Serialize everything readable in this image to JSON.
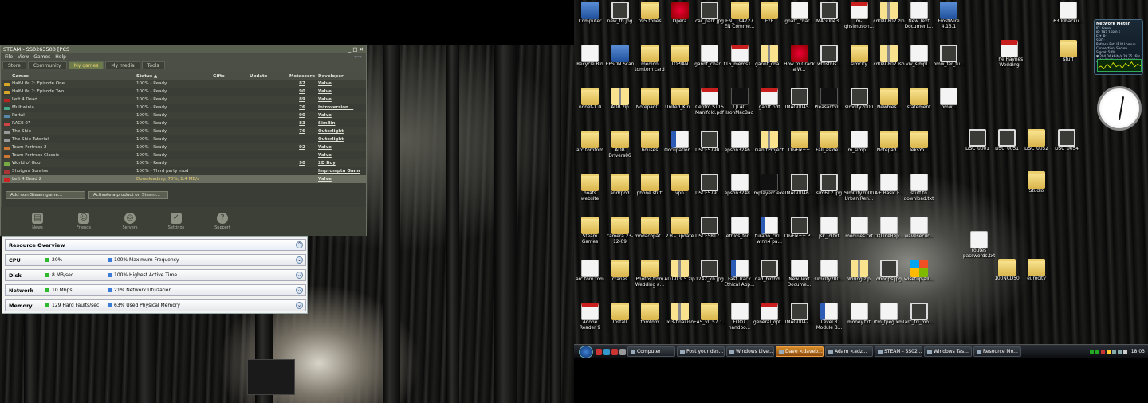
{
  "steam": {
    "title": "STEAM - SS0263500 [PCS",
    "menu": [
      "File",
      "View",
      "Games",
      "Help"
    ],
    "tabs": [
      "Store",
      "Community",
      "My games",
      "My media",
      "Tools"
    ],
    "columns": {
      "games": "Games",
      "status": "Status ▲",
      "gifts": "Gifts",
      "update": "Update",
      "meta": "Metascore",
      "dev": "Developer"
    },
    "games": [
      {
        "name": "Half-Life 2: Episode One",
        "status": "100% - Ready",
        "meta": "87",
        "dev": "Valve"
      },
      {
        "name": "Half-Life 2: Episode Two",
        "status": "100% - Ready",
        "meta": "90",
        "dev": "Valve"
      },
      {
        "name": "Left 4 Dead",
        "status": "100% - Ready",
        "meta": "89",
        "dev": "Valve"
      },
      {
        "name": "Multiwinia",
        "status": "100% - Ready",
        "meta": "76",
        "dev": "Introversion..."
      },
      {
        "name": "Portal",
        "status": "100% - Ready",
        "meta": "90",
        "dev": "Valve"
      },
      {
        "name": "RACE 07",
        "status": "100% - Ready",
        "meta": "83",
        "dev": "SimBin"
      },
      {
        "name": "The Ship",
        "status": "100% - Ready",
        "meta": "76",
        "dev": "Outerlight"
      },
      {
        "name": "The Ship Tutorial",
        "status": "100% - Ready",
        "meta": "",
        "dev": "Outerlight"
      },
      {
        "name": "Team Fortress 2",
        "status": "100% - Ready",
        "meta": "92",
        "dev": "Valve"
      },
      {
        "name": "Team Fortress Classic",
        "status": "100% - Ready",
        "meta": "",
        "dev": "Valve"
      },
      {
        "name": "World of Goo",
        "status": "100% - Ready",
        "meta": "90",
        "dev": "2D Boy"
      },
      {
        "name": "Shotgun Sunrise",
        "status": "100% - Third party mod",
        "meta": "",
        "dev": "Impromptu Game"
      },
      {
        "name": "Left 4 Dead 2",
        "status": "Downloading: 70%, 1.4 MB/s",
        "meta": "",
        "dev": "Valve"
      }
    ],
    "buttons": {
      "add": "Add non-Steam game...",
      "activate": "Activate a product on Steam..."
    },
    "bottom": [
      "News",
      "Friends",
      "Servers",
      "Settings",
      "Support"
    ]
  },
  "resmon": {
    "title": "Resource Overview",
    "rows": [
      {
        "label": "CPU",
        "v1": "20%",
        "v2": "100% Maximum Frequency",
        "c1": "#2db82d",
        "c2": "#3a7bd5"
      },
      {
        "label": "Disk",
        "v1": "8 MB/sec",
        "v2": "100% Highest Active Time",
        "c1": "#2db82d",
        "c2": "#3a7bd5"
      },
      {
        "label": "Network",
        "v1": "10 Mbps",
        "v2": "21% Network Utilization",
        "c1": "#2db82d",
        "c2": "#3a7bd5"
      },
      {
        "label": "Memory",
        "v1": "129 Hard Faults/sec",
        "v2": "63% Used Physical Memory",
        "c1": "#2db82d",
        "c2": "#3a7bd5"
      }
    ]
  },
  "desktop": {
    "col0": [
      {
        "label": "Computer",
        "type": "blue"
      },
      {
        "label": "Recycle Bin",
        "type": "doc"
      },
      {
        "label": "nonet-1.0",
        "type": "folder"
      },
      {
        "label": "arc tomtom",
        "type": "folder"
      },
      {
        "label": "boats website",
        "type": "folder"
      },
      {
        "label": "Steam Games",
        "type": "folder"
      },
      {
        "label": "arc tom tom",
        "type": "doc"
      },
      {
        "label": "Adobe Reader 9",
        "type": "pdf"
      }
    ],
    "col1": [
      {
        "label": "new_tb.jpg",
        "type": "img"
      },
      {
        "label": "EPSON Scan",
        "type": "blue"
      },
      {
        "label": "ADB.zip",
        "type": "zip"
      },
      {
        "label": "ADB Drivers86",
        "type": "folder"
      },
      {
        "label": "andrpod",
        "type": "folder"
      },
      {
        "label": "camera 23-12-09",
        "type": "folder"
      },
      {
        "label": "cranes",
        "type": "folder"
      },
      {
        "label": "Install",
        "type": "folder"
      }
    ],
    "col2": [
      {
        "label": "n95 tones",
        "type": "folder"
      },
      {
        "label": "medion tomtom card",
        "type": "folder"
      },
      {
        "label": "NotepadC...",
        "type": "folder"
      },
      {
        "label": "houses",
        "type": "folder"
      },
      {
        "label": "phone stuff",
        "type": "folder"
      },
      {
        "label": "modacopat...",
        "type": "folder"
      },
      {
        "label": "Photos from Wedding a...",
        "type": "folder"
      },
      {
        "label": "tomtom",
        "type": "folder"
      }
    ],
    "col3": [
      {
        "label": "Opera",
        "type": "red"
      },
      {
        "label": "TOPIAN",
        "type": "folder"
      },
      {
        "label": "United_Kin...",
        "type": "folder"
      },
      {
        "label": "Occupation...",
        "type": "word"
      },
      {
        "label": "vpn",
        "type": "folder"
      },
      {
        "label": "2.8 - update",
        "type": "folder"
      },
      {
        "label": "ADT-0.9.5.zip",
        "type": "zip"
      },
      {
        "label": "lxl3-final.iso",
        "type": "zip"
      }
    ],
    "col4": [
      {
        "label": "car_park.jpg",
        "type": "img"
      },
      {
        "label": "gannt_char...",
        "type": "doc"
      },
      {
        "label": "Centro ST15 Manifold.pdf",
        "type": "pdf"
      },
      {
        "label": "DSCF5790...",
        "type": "img"
      },
      {
        "label": "DSCF5791...",
        "type": "img"
      },
      {
        "label": "DSCF5817...",
        "type": "img"
      },
      {
        "label": "1242_kn.jpg",
        "type": "img"
      },
      {
        "label": "EA5_v0.57.1...",
        "type": "folder"
      }
    ],
    "col5": [
      {
        "label": "EN_...94727 EN Comme...",
        "type": "folder"
      },
      {
        "label": "t16_mems1...",
        "type": "pdf"
      },
      {
        "label": "LJLAC IsonMacBac",
        "type": "black"
      },
      {
        "label": "epson3246...",
        "type": "doc"
      },
      {
        "label": "epson3248...",
        "type": "doc"
      },
      {
        "label": "ethics_for...",
        "type": "doc"
      },
      {
        "label": "Fast Track Ethical App...",
        "type": "word"
      },
      {
        "label": "FOOT handbo...",
        "type": "doc"
      }
    ],
    "col6": [
      {
        "label": "FYP",
        "type": "folder"
      },
      {
        "label": "gannt_cha...",
        "type": "zip"
      },
      {
        "label": "gantt.pdf",
        "type": "pdf"
      },
      {
        "label": "GanttProject",
        "type": "zip"
      },
      {
        "label": "mplayerc.exe",
        "type": "black"
      },
      {
        "label": "turabo_ciri... winn4 pa...",
        "type": "word"
      },
      {
        "label": "dad_birthd...",
        "type": "img"
      },
      {
        "label": "general_opt...",
        "type": "pdf"
      }
    ],
    "col7": [
      {
        "label": "gnatt_char...",
        "type": "doc"
      },
      {
        "label": "How to Crack a W...",
        "type": "red"
      },
      {
        "label": "IMAG0045...",
        "type": "img"
      },
      {
        "label": "DivFix++",
        "type": "folder"
      },
      {
        "label": "IMAG0046...",
        "type": "img"
      },
      {
        "label": "DivFix++.P...",
        "type": "img"
      },
      {
        "label": "New Text Docume...",
        "type": "doc"
      },
      {
        "label": "IMAG0047...",
        "type": "img"
      }
    ],
    "col8": [
      {
        "label": "IMAG0043...",
        "type": "img"
      },
      {
        "label": "wtfisthis...",
        "type": "img"
      },
      {
        "label": "Pleasantvil...",
        "type": "black"
      },
      {
        "label": "Fall_aside...",
        "type": "folder"
      },
      {
        "label": "sim612.jpg",
        "type": "img"
      },
      {
        "label": "jsk_id.txt",
        "type": "doc"
      },
      {
        "label": "simcity200...",
        "type": "doc"
      },
      {
        "label": "Level 3 Module B...",
        "type": "word"
      }
    ],
    "col9": [
      {
        "label": "m-ghsimpson...",
        "type": "pdf"
      },
      {
        "label": "simcity",
        "type": "folder"
      },
      {
        "label": "simcity2000",
        "type": "img"
      },
      {
        "label": "m_simp...",
        "type": "doc"
      },
      {
        "label": "SimCity2000 Urban Ren...",
        "type": "doc"
      },
      {
        "label": "modules.txt",
        "type": "doc"
      },
      {
        "label": "Wiring.zip",
        "type": "zip"
      },
      {
        "label": "money.txt",
        "type": "doc"
      }
    ],
    "col10": [
      {
        "label": "cd080802.zip",
        "type": "zip"
      },
      {
        "label": "cd080802.iso",
        "type": "zip"
      },
      {
        "label": "Newbies...",
        "type": "folder"
      },
      {
        "label": "Notepad...",
        "type": "folder"
      },
      {
        "label": "A+ Basic F...",
        "type": "doc"
      },
      {
        "label": "OXLineRep...",
        "type": "doc"
      },
      {
        "label": "oboops.jpg",
        "type": "img"
      },
      {
        "label": "rtm_fpeg.xml",
        "type": "doc"
      }
    ],
    "col11": [
      {
        "label": "New Text Document...",
        "type": "doc"
      },
      {
        "label": "viv_simpl...",
        "type": "doc"
      },
      {
        "label": "statement",
        "type": "folder"
      },
      {
        "label": "TeksYo...",
        "type": "folder"
      },
      {
        "label": "stuff to download.txt",
        "type": "doc"
      },
      {
        "label": "wavesecur...",
        "type": "doc"
      },
      {
        "label": "wisetup-all...",
        "type": "win"
      },
      {
        "label": "arc_tri_mo...",
        "type": "img"
      }
    ],
    "col12": [
      {
        "label": "FrostWire 4.13.1",
        "type": "blue"
      },
      {
        "label": "bmw_fer_fu...",
        "type": "img"
      },
      {
        "label": "bmw...",
        "type": "doc"
      },
      {
        "label": "",
        "type": "none"
      },
      {
        "label": "",
        "type": "none"
      },
      {
        "label": "",
        "type": "none"
      },
      {
        "label": "",
        "type": "none"
      },
      {
        "label": "",
        "type": "none"
      }
    ],
    "extra": [
      {
        "label": "The Haynes Wedding",
        "type": "pdf"
      },
      {
        "label": "stuff",
        "type": "folder"
      },
      {
        "label": "6300backu...",
        "type": "doc"
      },
      {
        "label": "routes passwords.txt",
        "type": "doc"
      },
      {
        "label": "100NCD50",
        "type": "folder"
      },
      {
        "label": "eurocity",
        "type": "folder"
      },
      {
        "label": "DSC_0001",
        "type": "img"
      },
      {
        "label": "DSC_0051",
        "type": "img"
      },
      {
        "label": "DSC_0052",
        "type": "folder"
      },
      {
        "label": "DSC_0054",
        "type": "img"
      },
      {
        "label": "Studio",
        "type": "folder"
      }
    ]
  },
  "taskbar": {
    "buttons": [
      "Computer",
      "Post your des...",
      "Windows Live...",
      "Dave <daveb...",
      "Adam <adz...",
      "STEAM - SS02...",
      "Windows Tas...",
      "Resource Mo..."
    ],
    "clock": "18:03"
  },
  "gadget": {
    "title": "Network Meter",
    "lines": [
      "ID: Gauss",
      "IP: 192.168.0.5",
      "Ext IP: ...",
      "SSID: ...",
      "Refresh Ext. IP   IP Lookup",
      "Connection: Secure",
      "Signal: 58%",
      "▼ 204.04 kbits/s  29.35 kB/s",
      "▲ 10.84 Mbit/s  1.330 MB/s"
    ]
  }
}
